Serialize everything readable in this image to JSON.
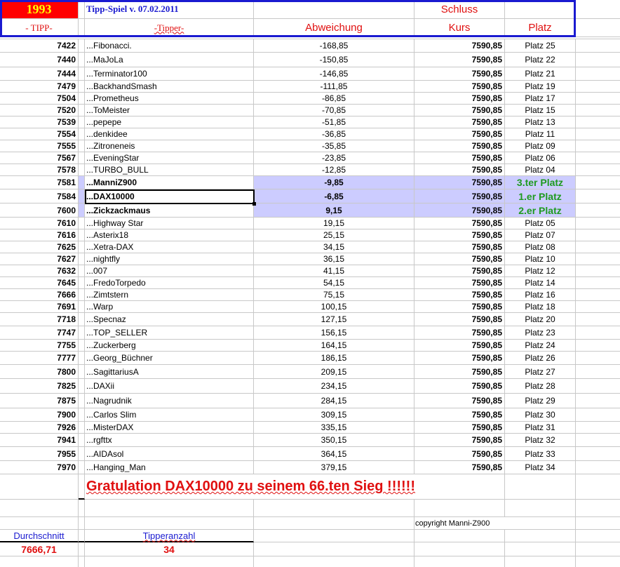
{
  "header": {
    "year": "1993",
    "title": "Tipp-Spiel v. 07.02.2011",
    "col_tipp": "- TIPP-",
    "col_tipper": "-Tipper-",
    "col_abweichung": "Abweichung",
    "col_schluss": "Schluss",
    "col_kurs": "Kurs",
    "col_platz": "Platz"
  },
  "rows": [
    {
      "tipp": "7422",
      "name": "...Fibonacci.",
      "abw": "-168,85",
      "kurs": "7590,85",
      "platz": "Platz 25"
    },
    {
      "tipp": "7440",
      "name": "...MaJoLa",
      "abw": "-150,85",
      "kurs": "7590,85",
      "platz": "Platz 22"
    },
    {
      "tipp": "7444",
      "name": "...Terminator100",
      "abw": "-146,85",
      "kurs": "7590,85",
      "platz": "Platz 21"
    },
    {
      "tipp": "7479",
      "name": "...BackhandSmash",
      "abw": "-111,85",
      "kurs": "7590,85",
      "platz": "Platz 19"
    },
    {
      "tipp": "7504",
      "name": "...Prometheus",
      "abw": "-86,85",
      "kurs": "7590,85",
      "platz": "Platz 17"
    },
    {
      "tipp": "7520",
      "name": "...ToMeister",
      "abw": "-70,85",
      "kurs": "7590,85",
      "platz": "Platz 15"
    },
    {
      "tipp": "7539",
      "name": "...pepepe",
      "abw": "-51,85",
      "kurs": "7590,85",
      "platz": "Platz 13"
    },
    {
      "tipp": "7554",
      "name": "...denkidee",
      "abw": "-36,85",
      "kurs": "7590,85",
      "platz": "Platz 11"
    },
    {
      "tipp": "7555",
      "name": "...Zitroneneis",
      "abw": "-35,85",
      "kurs": "7590,85",
      "platz": "Platz 09"
    },
    {
      "tipp": "7567",
      "name": "...EveningStar",
      "abw": "-23,85",
      "kurs": "7590,85",
      "platz": "Platz 06"
    },
    {
      "tipp": "7578",
      "name": "...TURBO_BULL",
      "abw": "-12,85",
      "kurs": "7590,85",
      "platz": "Platz 04"
    },
    {
      "tipp": "7581",
      "name": "...ManniZ900",
      "abw": "-9,85",
      "kurs": "7590,85",
      "platz": "3.ter Platz",
      "highlight": true
    },
    {
      "tipp": "7584",
      "name": "...DAX10000",
      "abw": "-6,85",
      "kurs": "7590,85",
      "platz": "1.er Platz",
      "highlight": true
    },
    {
      "tipp": "7600",
      "name": "...Zickzackmaus",
      "abw": "9,15",
      "kurs": "7590,85",
      "platz": "2.er Platz",
      "highlight": true
    },
    {
      "tipp": "7610",
      "name": "...Highway Star",
      "abw": "19,15",
      "kurs": "7590,85",
      "platz": "Platz 05"
    },
    {
      "tipp": "7616",
      "name": "...Asterix18",
      "abw": "25,15",
      "kurs": "7590,85",
      "platz": "Platz 07"
    },
    {
      "tipp": "7625",
      "name": "...Xetra-DAX",
      "abw": "34,15",
      "kurs": "7590,85",
      "platz": "Platz 08"
    },
    {
      "tipp": "7627",
      "name": "...nightfly",
      "abw": "36,15",
      "kurs": "7590,85",
      "platz": "Platz 10"
    },
    {
      "tipp": "7632",
      "name": "...007",
      "abw": "41,15",
      "kurs": "7590,85",
      "platz": "Platz 12"
    },
    {
      "tipp": "7645",
      "name": "...FredoTorpedo",
      "abw": "54,15",
      "kurs": "7590,85",
      "platz": "Platz 14"
    },
    {
      "tipp": "7666",
      "name": "...Zimtstern",
      "abw": "75,15",
      "kurs": "7590,85",
      "platz": "Platz 16"
    },
    {
      "tipp": "7691",
      "name": "...Warp",
      "abw": "100,15",
      "kurs": "7590,85",
      "platz": "Platz 18"
    },
    {
      "tipp": "7718",
      "name": "...Specnaz",
      "abw": "127,15",
      "kurs": "7590,85",
      "platz": "Platz 20"
    },
    {
      "tipp": "7747",
      "name": "...TOP_SELLER",
      "abw": "156,15",
      "kurs": "7590,85",
      "platz": "Platz 23"
    },
    {
      "tipp": "7755",
      "name": "...Zuckerberg",
      "abw": "164,15",
      "kurs": "7590,85",
      "platz": "Platz 24"
    },
    {
      "tipp": "7777",
      "name": "...Georg_Büchner",
      "abw": "186,15",
      "kurs": "7590,85",
      "platz": "Platz 26"
    },
    {
      "tipp": "7800",
      "name": "...SagittariusA",
      "abw": "209,15",
      "kurs": "7590,85",
      "platz": "Platz 27"
    },
    {
      "tipp": "7825",
      "name": "...DAXii",
      "abw": "234,15",
      "kurs": "7590,85",
      "platz": "Platz 28"
    },
    {
      "tipp": "7875",
      "name": "...Nagrudnik",
      "abw": "284,15",
      "kurs": "7590,85",
      "platz": "Platz 29"
    },
    {
      "tipp": "7900",
      "name": "...Carlos Slim",
      "abw": "309,15",
      "kurs": "7590,85",
      "platz": "Platz 30"
    },
    {
      "tipp": "7926",
      "name": "...MisterDAX",
      "abw": "335,15",
      "kurs": "7590,85",
      "platz": "Platz 31"
    },
    {
      "tipp": "7941",
      "name": "...rgfttx",
      "abw": "350,15",
      "kurs": "7590,85",
      "platz": "Platz 32"
    },
    {
      "tipp": "7955",
      "name": "...AIDAsol",
      "abw": "364,15",
      "kurs": "7590,85",
      "platz": "Platz 33"
    },
    {
      "tipp": "7970",
      "name": "...Hanging_Man",
      "abw": "379,15",
      "kurs": "7590,85",
      "platz": "Platz 34"
    }
  ],
  "footer": {
    "gratulation": "Gratulation  DAX10000  zu seinem 66.ten Sieg !!!!!!",
    "copyright": "copyright Manni-Z900",
    "durchschnitt_label": "Durchschnitt",
    "durchschnitt_value": "7666,71",
    "tipperanzahl_label": "Tipperanzahl",
    "tipperanzahl_value": "34"
  },
  "colors": {
    "header_red": "#e01010",
    "year_bg": "#ff0000",
    "year_text": "#ffff00",
    "border_blue": "#1a1ad0",
    "highlight": "#ccccff",
    "winner_green": "#1e9a1e"
  }
}
